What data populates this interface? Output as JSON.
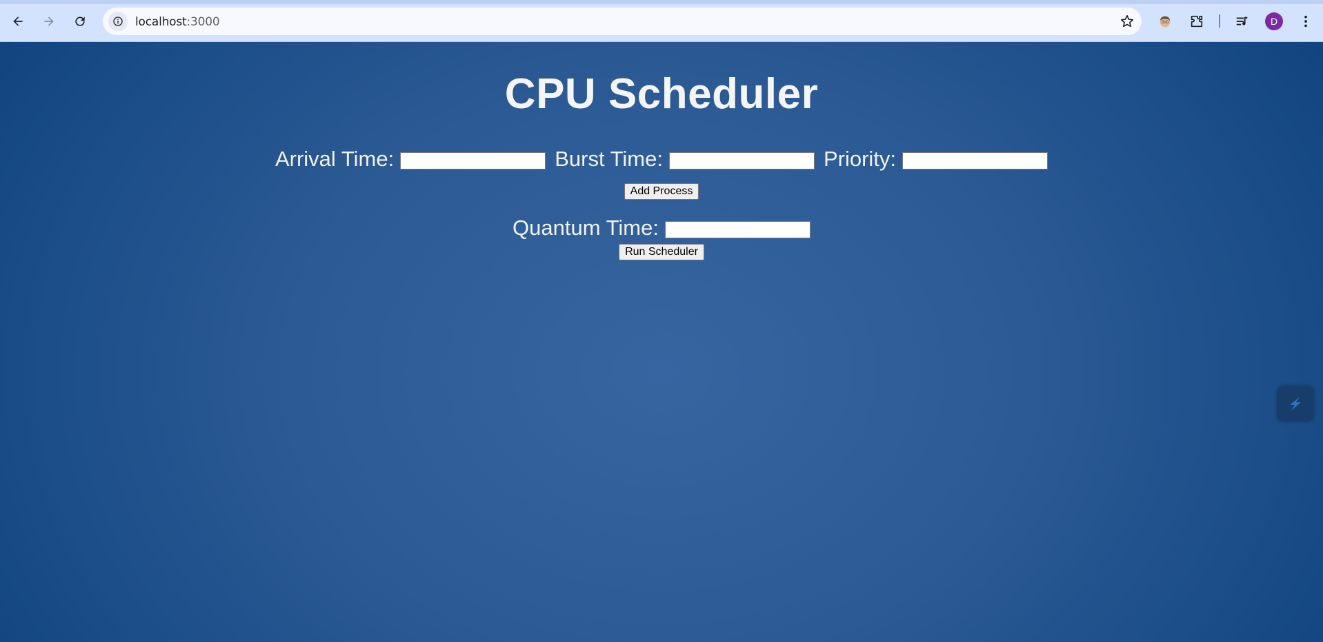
{
  "browser": {
    "url_host": "localhost",
    "url_port": ":3000",
    "avatar_letter": "D",
    "accent_color": "#4a89e8"
  },
  "page": {
    "title": "CPU Scheduler",
    "arrival_label": "Arrival Time:",
    "arrival_value": "",
    "burst_label": "Burst Time:",
    "burst_value": "",
    "priority_label": "Priority:",
    "priority_value": "",
    "add_button": "Add Process",
    "quantum_label": "Quantum Time:",
    "quantum_value": "",
    "run_button": "Run Scheduler",
    "background_colors": [
      "#3665a0",
      "#0a3c73"
    ]
  }
}
